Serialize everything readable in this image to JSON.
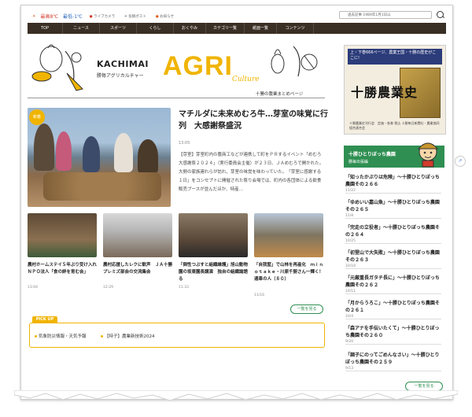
{
  "topbar": {
    "temp_high": "最高8℃",
    "temp_low": "最低-1℃",
    "chips": [
      "ライブカメラ",
      "投稿ポスト",
      "お知らせ"
    ],
    "search_placeholder": "過去記事 1989年1月1日以",
    "search_icon": "search-icon"
  },
  "nav": {
    "items": [
      "TOP",
      "ニュース",
      "スポーツ",
      "くらし",
      "おくやみ",
      "カテゴリ一覧",
      "紙面一覧",
      "コンテンツ"
    ]
  },
  "banner": {
    "kachimai": "KACHIMAI",
    "sub": "勝毎アグリカルチャー",
    "agri": "AGRI",
    "culture": "Culture",
    "summary": "十勝の農業まとめページ"
  },
  "featured": {
    "badge": "新着",
    "title": "マチルダに未来めむろ牛…芽室の味覚に行列　大感謝祭盛況",
    "date": "13:05",
    "body": "【芽室】芽室町内の農商工などが連携して町をＰＲするイベント「めむろ大感謝祭２０２４」（実行委員会主催）が２３日、ＪＡめむろで開かれた。大勢の家族連れらが訪れ、芽室の味覚を味わっていた。　「芽室に感謝する１日」をコンセプトに開催された祭り会場では、町内の各団体による飲食販売ブースが並んだほか、特産…"
  },
  "cards": [
    {
      "title": "農村ホームステイ５年ぶり受け入れ　ＮＰＯ法人「食の絆を育む会」",
      "date": "13:04"
    },
    {
      "title": "農村応援したレクに歓声　ＪＡ十勝プレミズ部会の交流集会",
      "date": "12:29"
    },
    {
      "title": "「倒性つぶすと組織維護」旭山動物園の坂東園長講演　独自の組織論語る",
      "date": "11:33"
    },
    {
      "title": "「自我堅」で山林を再産化　ｍｉｎｏｔａｋｅ・川原千厨さん一輝く！通車の人（８０）",
      "date": "11/16"
    }
  ],
  "more_label": "一覧を見る",
  "pickup": {
    "tab": "PICK UP",
    "items": [
      "気象防災情報・天気予報",
      "【特子】農業新技術2024"
    ]
  },
  "ad": {
    "header": "上・下巻666ページ、農業王国・十勝の歴史がここに!",
    "big": "十勝農業史",
    "footer": "十勝農業史刊行会　定価・各巻 税込 十勝毎日新聞社・農業協同組合連合会"
  },
  "sidebar": {
    "title": "十勝ひとりぼっち農園",
    "sub": "勝毎出張編",
    "items": [
      {
        "title": "「知ったかぶりは危険」〜十勝ひとりぼっち農園その２６６",
        "date": "11/22"
      },
      {
        "title": "「ゆめいい嘉山魚」〜十勝ひとりぼっち農園その２６５",
        "date": "11/8"
      },
      {
        "title": "「完走の立役者」〜十勝ひとりぼっち農園その２６４",
        "date": "10/25"
      },
      {
        "title": "「初登山で大失敗」〜十勝ひとりぼっち農園その２６３",
        "date": "10/18"
      },
      {
        "title": "「元厳重長ガタチ長に」〜十勝ひとりぼっち農園その２６２",
        "date": "10/11"
      },
      {
        "title": "「月からうろこ」〜十勝ひとりぼっち農園その２６１",
        "date": "10/4"
      },
      {
        "title": "「森アナを手伝いたくて」〜十勝ひとりぼっち農園その２６０",
        "date": "9/20"
      },
      {
        "title": "「調子にのってごめんなさい」〜十勝ひとりぼっち農園その２５９",
        "date": "9/13"
      }
    ]
  },
  "colors": {
    "nav_bg": "#3a2f25",
    "accent_yellow": "#f0b400",
    "green": "#2f8f52"
  }
}
